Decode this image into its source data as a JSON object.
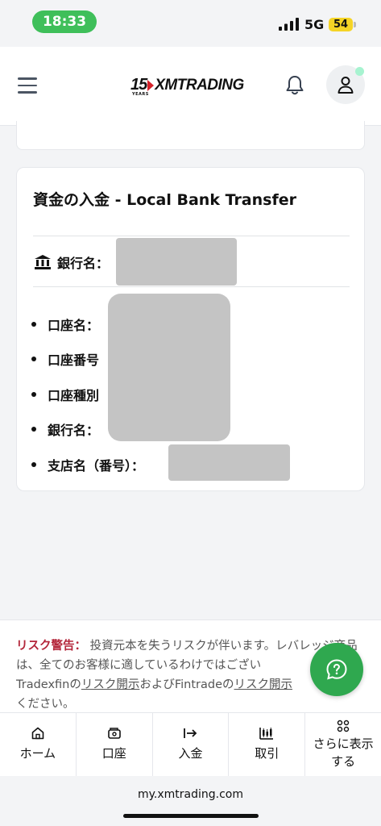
{
  "status_bar": {
    "time": "18:33",
    "network": "5G",
    "battery": "54"
  },
  "header": {
    "logo_number": "15",
    "logo_text": "XMTRADING",
    "logo_years": "YEARS",
    "menu_icon": "hamburger-menu-icon",
    "notification_icon": "bell-icon",
    "account_icon": "user-icon"
  },
  "deposit_card": {
    "title": "資金の入金 - Local Bank Transfer",
    "bank_label": "銀行名：",
    "bank_icon": "bank-icon",
    "details": [
      {
        "label": "口座名："
      },
      {
        "label": "口座番号"
      },
      {
        "label": "口座種別"
      },
      {
        "label": "銀行名："
      },
      {
        "label": "支店名（番号）："
      }
    ]
  },
  "risk_warning": {
    "label": "リスク警告：",
    "text1": " 投資元本を失うリスクが伴います。レバレッジ商品は、全てのお客様に適しているわけではござい",
    "text2": "Tradexfinの",
    "link1": "リスク開示",
    "text3": "およびFintradeの",
    "link2": "リスク開示",
    "text4": "ください。"
  },
  "help_fab_icon": "help-question-icon",
  "bottom_nav": [
    {
      "label": "ホーム",
      "icon": "home-icon"
    },
    {
      "label": "口座",
      "icon": "wallet-icon"
    },
    {
      "label": "入金",
      "icon": "deposit-arrow-icon"
    },
    {
      "label": "取引",
      "icon": "candlestick-chart-icon"
    },
    {
      "label": "さらに表示する",
      "icon": "grid-dots-icon"
    }
  ],
  "browser": {
    "url": "my.xmtrading.com"
  },
  "colors": {
    "brand_green": "#2fa84f",
    "risk_red": "#b3263a",
    "status_green": "#3fbf5a"
  }
}
